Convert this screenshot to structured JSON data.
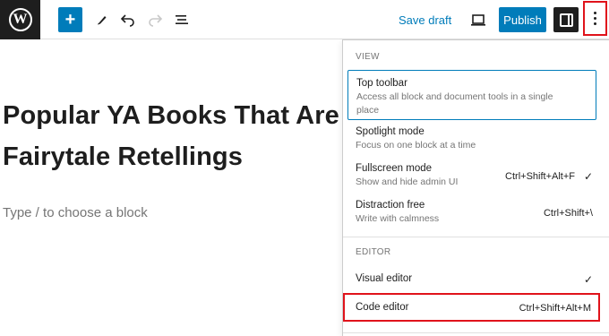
{
  "toolbar": {
    "logo_glyph": "W",
    "add_label": "+",
    "save_draft_label": "Save draft",
    "publish_label": "Publish",
    "icons": [
      "wordpress-logo-icon",
      "plus-icon",
      "pen-icon",
      "undo-icon",
      "redo-icon",
      "list-view-icon",
      "desktop-preview-icon",
      "settings-panel-icon",
      "more-options-icon"
    ]
  },
  "editor": {
    "title": "Popular YA Books That Are Fairytale Retellings",
    "block_placeholder": "Type / to choose a block"
  },
  "menu": {
    "view_label": "VIEW",
    "editor_label": "EDITOR",
    "view_items": [
      {
        "title": "Top toolbar",
        "description": "Access all block and document tools in a single place",
        "shortcut": "",
        "checked": false
      },
      {
        "title": "Spotlight mode",
        "description": "Focus on one block at a time",
        "shortcut": "",
        "checked": false
      },
      {
        "title": "Fullscreen mode",
        "description": "Show and hide admin UI",
        "shortcut": "Ctrl+Shift+Alt+F",
        "checked": true
      },
      {
        "title": "Distraction free",
        "description": "Write with calmness",
        "shortcut": "Ctrl+Shift+\\",
        "checked": false
      }
    ],
    "editor_items": [
      {
        "title": "Visual editor",
        "shortcut": "",
        "checked": true
      },
      {
        "title": "Code editor",
        "shortcut": "Ctrl+Shift+Alt+M",
        "checked": false
      }
    ],
    "check_glyph": "✓"
  },
  "colors": {
    "accent": "#007cba",
    "highlight": "#e0131b",
    "dark": "#1e1e1e"
  }
}
